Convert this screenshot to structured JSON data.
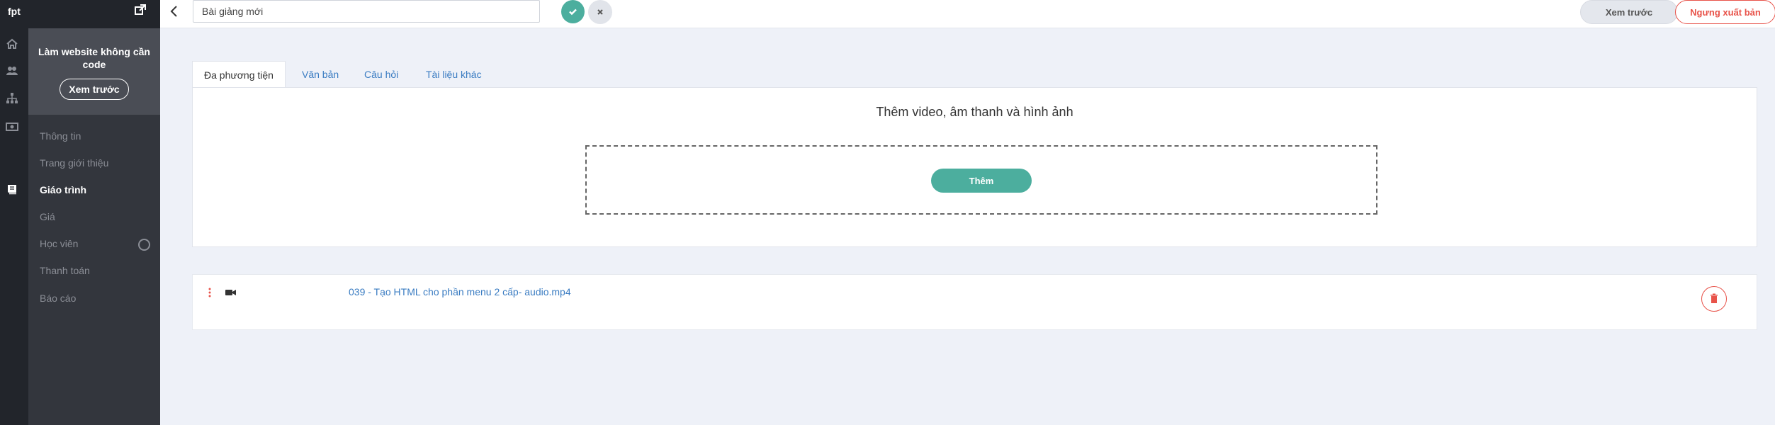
{
  "brand": "fpt",
  "sidebar": {
    "promo_text": "Làm website không cần code",
    "promo_button": "Xem trước",
    "items": [
      {
        "label": "Thông tin"
      },
      {
        "label": "Trang giới thiệu"
      },
      {
        "label": "Giáo trình"
      },
      {
        "label": "Giá"
      },
      {
        "label": "Học viên"
      },
      {
        "label": "Thanh toán"
      },
      {
        "label": "Báo cáo"
      }
    ],
    "active_item": "Giáo trình"
  },
  "rail_icons": [
    "home-icon",
    "users-icon",
    "sitemap-icon",
    "money-icon",
    "book-icon"
  ],
  "topbar": {
    "title_value": "Bài giảng mới",
    "preview_label": "Xem trước",
    "unpublish_label": "Ngưng xuất bản"
  },
  "tabs": [
    {
      "label": "Đa phương tiện"
    },
    {
      "label": "Văn bản"
    },
    {
      "label": "Câu hỏi"
    },
    {
      "label": "Tài liệu khác"
    }
  ],
  "active_tab": "Đa phương tiện",
  "media": {
    "heading": "Thêm video, âm thanh và hình ảnh",
    "add_label": "Thêm"
  },
  "files": [
    {
      "name": "039 - Tạo HTML cho phần menu 2 cấp- audio.mp4",
      "type": "video"
    }
  ],
  "colors": {
    "accent": "#4cae9e",
    "danger": "#e8534a",
    "link": "#3a7cc2",
    "sidebar_bg": "#33363d",
    "rail_bg": "#22252b"
  }
}
